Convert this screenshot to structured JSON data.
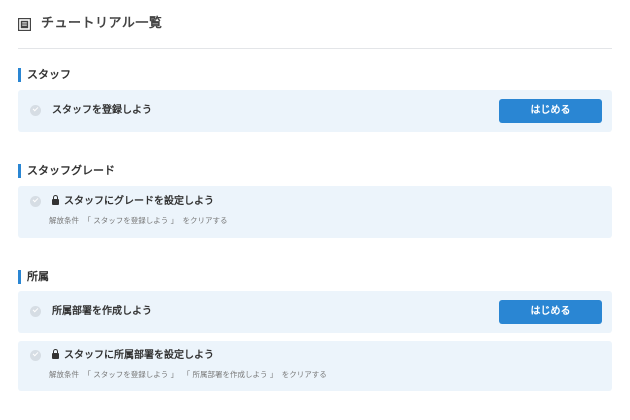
{
  "header": {
    "title": "チュートリアル一覧",
    "icon": "book-icon"
  },
  "sections": [
    {
      "title": "スタッフ"
    },
    {
      "title": "スタッフグレード"
    },
    {
      "title": "所属"
    }
  ],
  "cards": [
    {
      "title": "スタッフを登録しよう",
      "button": "はじめる"
    },
    {
      "title": "スタッフにグレードを設定しよう",
      "locked": true,
      "condition_label": "解放条件",
      "conditions": [
        "「 スタッフを登録しよう 」"
      ],
      "condition_suffix": "をクリアする"
    },
    {
      "title": "所属部署を作成しよう",
      "button": "はじめる"
    },
    {
      "title": "スタッフに所属部署を設定しよう",
      "locked": true,
      "condition_label": "解放条件",
      "conditions": [
        "「 スタッフを登録しよう 」",
        "「 所属部署を作成しよう 」"
      ],
      "condition_suffix": "をクリアする"
    }
  ],
  "colors": {
    "accent": "#2a86d3",
    "card_bg": "#ecf4fb",
    "check": "#d6dde4"
  }
}
